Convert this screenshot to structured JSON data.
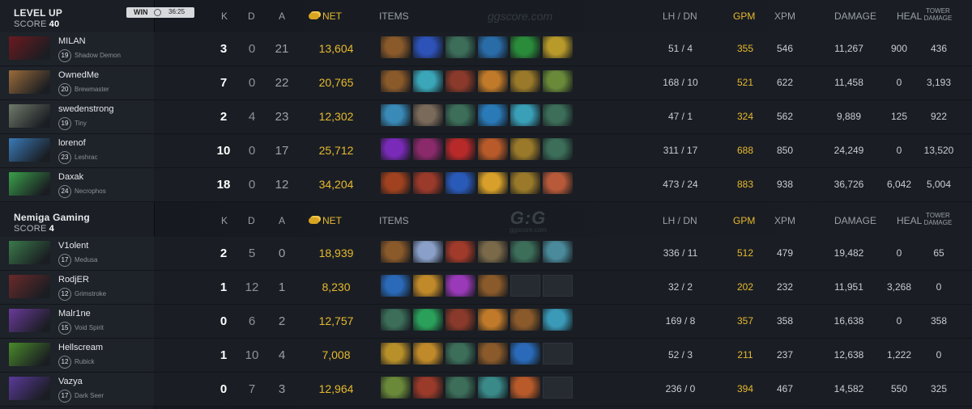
{
  "teams": [
    {
      "name": "LEVEL UP",
      "score_label": "SCORE",
      "score": "40",
      "result": "WIN",
      "duration": "36:25",
      "players": [
        {
          "name": "MILAN",
          "level": "19",
          "hero": "Shadow Demon",
          "k": "3",
          "d": "0",
          "a": "21",
          "net": "13,604",
          "lh": "51",
          "dn": "4",
          "gpm": "355",
          "xpm": "546",
          "damage": "11,267",
          "heal": "900",
          "tower": "436",
          "portrait_color": "#6b1a1f",
          "items": [
            "#8a5a2b",
            "#2d52b8",
            "#3c6e5a",
            "#2a6ca8",
            "#2a8b3a",
            "#b79a2a"
          ]
        },
        {
          "name": "OwnedMe",
          "level": "20",
          "hero": "Brewmaster",
          "k": "7",
          "d": "0",
          "a": "22",
          "net": "20,765",
          "lh": "168",
          "dn": "10",
          "gpm": "521",
          "xpm": "622",
          "damage": "11,458",
          "heal": "0",
          "tower": "3,193",
          "portrait_color": "#9a6b3a",
          "items": [
            "#8a5a2b",
            "#3aa6b8",
            "#8a3a2a",
            "#c07a2a",
            "#9a7a2a",
            "#6a8a3a"
          ]
        },
        {
          "name": "swedenstrong",
          "level": "19",
          "hero": "Tiny",
          "k": "2",
          "d": "4",
          "a": "23",
          "net": "12,302",
          "lh": "47",
          "dn": "1",
          "gpm": "324",
          "xpm": "562",
          "damage": "9,889",
          "heal": "125",
          "tower": "922",
          "portrait_color": "#6f7a6a",
          "items": [
            "#3a8ab8",
            "#7a6a5a",
            "#3c6e5a",
            "#2a7ab8",
            "#3aa0b8",
            "#3c6e5a"
          ]
        },
        {
          "name": "lorenof",
          "level": "23",
          "hero": "Leshrac",
          "k": "10",
          "d": "0",
          "a": "17",
          "net": "25,712",
          "lh": "311",
          "dn": "17",
          "gpm": "688",
          "xpm": "850",
          "damage": "24,249",
          "heal": "0",
          "tower": "13,520",
          "portrait_color": "#3a7ab8",
          "items": [
            "#7a2ab8",
            "#8a2a6a",
            "#b82a2a",
            "#b85a2a",
            "#9a7a2a",
            "#3c6e5a"
          ]
        },
        {
          "name": "Daxak",
          "level": "24",
          "hero": "Necrophos",
          "k": "18",
          "d": "0",
          "a": "12",
          "net": "34,204",
          "lh": "473",
          "dn": "24",
          "gpm": "883",
          "xpm": "938",
          "damage": "36,726",
          "heal": "6,042",
          "tower": "5,004",
          "portrait_color": "#3aa04a",
          "items": [
            "#a0421f",
            "#9a3a2a",
            "#2a5ab8",
            "#d8a02a",
            "#9a7a2a",
            "#b85a3a"
          ]
        }
      ]
    },
    {
      "name": "Nemiga Gaming",
      "score_label": "SCORE",
      "score": "4",
      "players": [
        {
          "name": "V1olent",
          "level": "17",
          "hero": "Medusa",
          "k": "2",
          "d": "5",
          "a": "0",
          "net": "18,939",
          "lh": "336",
          "dn": "11",
          "gpm": "512",
          "xpm": "479",
          "damage": "19,482",
          "heal": "0",
          "tower": "65",
          "portrait_color": "#3a7a4a",
          "items": [
            "#8a5a2b",
            "#8aa0c8",
            "#a03a2a",
            "#7a6a4a",
            "#3c6e5a",
            "#4a8a9a"
          ]
        },
        {
          "name": "RodjER",
          "level": "12",
          "hero": "Grimstroke",
          "k": "1",
          "d": "12",
          "a": "1",
          "net": "8,230",
          "lh": "32",
          "dn": "2",
          "gpm": "202",
          "xpm": "232",
          "damage": "11,951",
          "heal": "3,268",
          "tower": "0",
          "portrait_color": "#6a2a2a",
          "items": [
            "#2a6ab8",
            "#c08a2a",
            "#9a3ab8",
            "#8a5a2b",
            "",
            ""
          ]
        },
        {
          "name": "Malr1ne",
          "level": "15",
          "hero": "Void Spirit",
          "k": "0",
          "d": "6",
          "a": "2",
          "net": "12,757",
          "lh": "169",
          "dn": "8",
          "gpm": "357",
          "xpm": "358",
          "damage": "16,638",
          "heal": "0",
          "tower": "358",
          "portrait_color": "#6a3a9a",
          "items": [
            "#3c6e5a",
            "#2aa05a",
            "#8a3a2a",
            "#c07a2a",
            "#8a5a2b",
            "#3a9ab8"
          ]
        },
        {
          "name": "Hellscream",
          "level": "12",
          "hero": "Rubick",
          "k": "1",
          "d": "10",
          "a": "4",
          "net": "7,008",
          "lh": "52",
          "dn": "3",
          "gpm": "211",
          "xpm": "237",
          "damage": "12,638",
          "heal": "1,222",
          "tower": "0",
          "portrait_color": "#4a8a2a",
          "items": [
            "#b8902a",
            "#c08a2a",
            "#3c6e5a",
            "#8a5a2b",
            "#2a6ab8",
            ""
          ]
        },
        {
          "name": "Vazya",
          "level": "17",
          "hero": "Dark Seer",
          "k": "0",
          "d": "7",
          "a": "3",
          "net": "12,964",
          "lh": "236",
          "dn": "0",
          "gpm": "394",
          "xpm": "467",
          "damage": "14,582",
          "heal": "550",
          "tower": "325",
          "portrait_color": "#5a3a9a",
          "items": [
            "#6a8a3a",
            "#9a3a2a",
            "#3c6e5a",
            "#3a8a8a",
            "#b85a2a",
            ""
          ]
        }
      ]
    }
  ],
  "headers": {
    "k": "K",
    "d": "D",
    "a": "A",
    "net": "NET",
    "items": "ITEMS",
    "lh_dn": "LH / DN",
    "gpm": "GPM",
    "xpm": "XPM",
    "damage": "DAMAGE",
    "heal": "HEAL",
    "tower": "TOWER DAMAGE"
  },
  "watermark": "ggscore.com",
  "watermark_logo": "G:G",
  "watermark_small": "ggscore.com"
}
